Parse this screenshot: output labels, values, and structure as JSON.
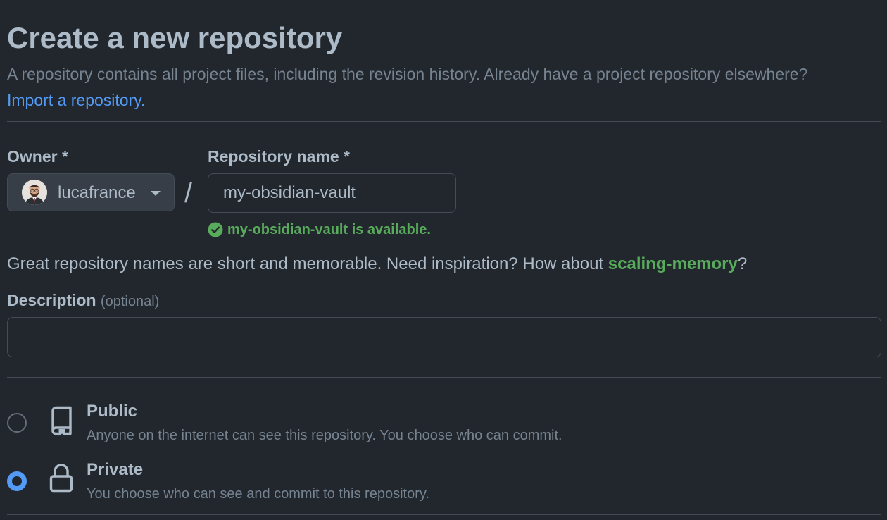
{
  "header": {
    "title": "Create a new repository",
    "subtitle": "A repository contains all project files, including the revision history. Already have a project repository elsewhere?",
    "import_link": "Import a repository."
  },
  "owner": {
    "label": "Owner *",
    "value": "lucafrance"
  },
  "separator": "/",
  "repository_name": {
    "label": "Repository name *",
    "value": "my-obsidian-vault",
    "availability": "my-obsidian-vault is available."
  },
  "hint": {
    "text_before": "Great repository names are short and memorable. Need inspiration? How about ",
    "suggestion": "scaling-memory",
    "text_after": "?"
  },
  "description": {
    "label": "Description",
    "optional": "(optional)",
    "value": ""
  },
  "visibility": {
    "options": [
      {
        "title": "Public",
        "description": "Anyone on the internet can see this repository. You choose who can commit.",
        "icon": "repo-icon",
        "selected": false
      },
      {
        "title": "Private",
        "description": "You choose who can see and commit to this repository.",
        "icon": "lock-icon",
        "selected": true
      }
    ]
  },
  "colors": {
    "background": "#22272e",
    "link": "#539bf5",
    "success": "#57ab5a",
    "border": "#444c56"
  }
}
